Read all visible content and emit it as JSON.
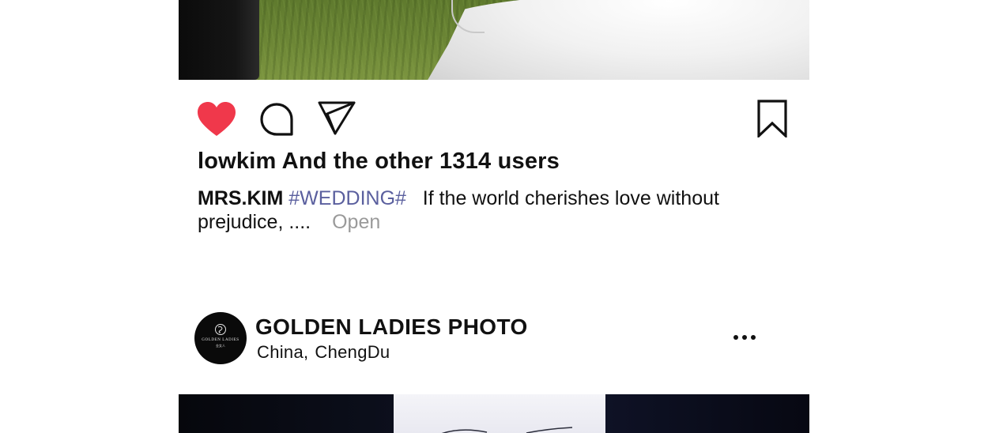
{
  "post_actions": {
    "like_icon": "heart-filled-icon",
    "comment_icon": "comment-bubble-icon",
    "share_icon": "send-icon",
    "save_icon": "bookmark-icon",
    "like_color": "#f0384b"
  },
  "likes": {
    "user": "lowkim",
    "rest": " And the other 1314 users"
  },
  "caption": {
    "author": "MRS.KIM",
    "hashtag": "#WEDDING#",
    "text": "If the world cherishes love without prejudice, ....",
    "open_link": "Open"
  },
  "next_post": {
    "account_name": "GOLDEN LADIES PHOTO",
    "location_country": "China,",
    "location_city": "ChengDu",
    "avatar_logo_text": "GOLDEN LADIES",
    "avatar_logo_sub": "金女人",
    "more_icon": "more-dots-icon"
  }
}
